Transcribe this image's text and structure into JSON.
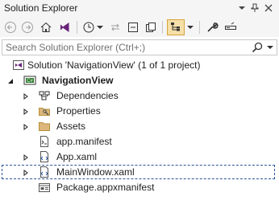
{
  "window": {
    "title": "Solution Explorer"
  },
  "search": {
    "placeholder": "Search Solution Explorer (Ctrl+;)"
  },
  "tree": [
    {
      "label": "Solution 'NavigationView' (1 of 1 project)",
      "icon": "solution-icon",
      "expander": "none",
      "bold": false
    },
    {
      "label": "NavigationView",
      "icon": "csharp-project-icon",
      "expander": "expanded",
      "bold": true
    },
    {
      "label": "Dependencies",
      "icon": "dependencies-icon",
      "expander": "collapsed",
      "bold": false
    },
    {
      "label": "Properties",
      "icon": "properties-icon",
      "expander": "collapsed",
      "bold": false
    },
    {
      "label": "Assets",
      "icon": "folder-icon",
      "expander": "collapsed",
      "bold": false
    },
    {
      "label": "app.manifest",
      "icon": "manifest-file-icon",
      "expander": "none",
      "bold": false
    },
    {
      "label": "App.xaml",
      "icon": "xaml-file-icon",
      "expander": "collapsed",
      "bold": false
    },
    {
      "label": "MainWindow.xaml",
      "icon": "xaml-file-icon",
      "expander": "collapsed",
      "bold": false,
      "selected": true
    },
    {
      "label": "Package.appxmanifest",
      "icon": "appxmanifest-icon",
      "expander": "none",
      "bold": false
    }
  ],
  "colors": {
    "accent": "#2b579a",
    "active_tool": "#f5dfa8",
    "folder": "#dcb67a"
  }
}
